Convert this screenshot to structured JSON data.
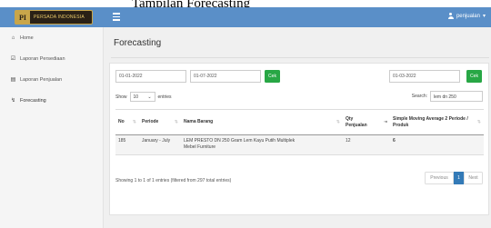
{
  "caption": "Tampilan Forecasting",
  "header": {
    "logo_mark": "PI",
    "logo_text": "PERSADA INDONESIA",
    "user_label": "penjualan",
    "user_caret": "▾"
  },
  "sidebar": {
    "items": [
      {
        "icon": "⌂",
        "label": "Home"
      },
      {
        "icon": "☑",
        "label": "Laporan Persediaan"
      },
      {
        "icon": "▤",
        "label": "Laporan Penjualan"
      },
      {
        "icon": "↯",
        "label": "Forecasting"
      }
    ]
  },
  "main": {
    "title": "Forecasting",
    "filters": {
      "date_from": "01-01-2022",
      "date_to": "01-07-2022",
      "cek_label": "Cek",
      "date_single": "01-03-2022",
      "cek2_label": "Cek"
    },
    "length": {
      "show": "Show",
      "value": "10",
      "entries": "entries"
    },
    "search": {
      "label": "Search:",
      "value": "lem dn 250"
    },
    "table": {
      "headers": [
        "No",
        "Periode",
        "Nama Barang",
        "Qty Penjualan",
        "Simple Moving Average 2 Periode / Produk"
      ],
      "rows": [
        {
          "no": "185",
          "periode": "January - July",
          "nama": "LEM PRESTO DN 250 Gram Lem Kayu Putih Multiplek Mebel Furniture",
          "qty": "12",
          "sma": "6"
        }
      ]
    },
    "info": "Showing 1 to 1 of 1 entries (filtered from 297 total entries)",
    "pager": {
      "previous": "Previous",
      "page": "1",
      "next": "Next"
    }
  }
}
